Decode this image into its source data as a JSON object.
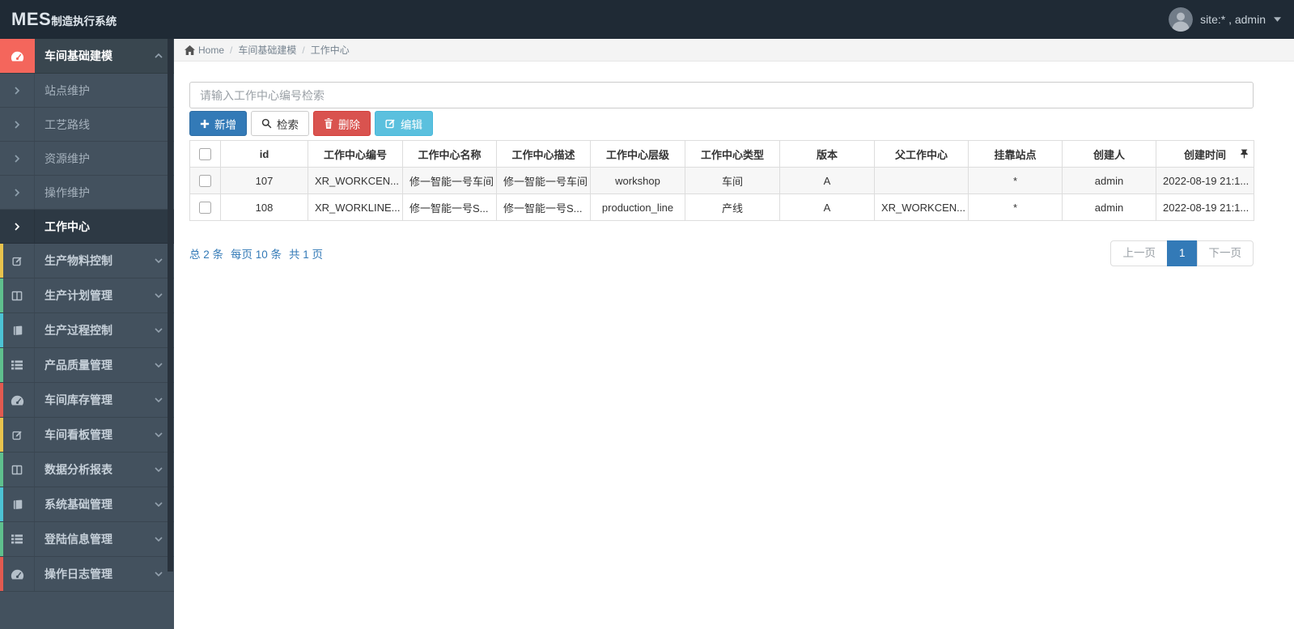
{
  "app": {
    "title_abbr": "MES",
    "title_rest": "制造执行系统"
  },
  "navbar": {
    "user": {
      "label": "site:* , admin",
      "avatar_icon": "user-avatar",
      "caret_icon": "caret-down-icon"
    }
  },
  "sidebar": {
    "items": [
      {
        "kind": "parent",
        "name": "workshop-modeling",
        "label": "车间基础建模",
        "icon": "tachometer-icon",
        "active": true,
        "expanded": true,
        "icon_bg": "#f4665c"
      },
      {
        "kind": "sub",
        "name": "station-maintenance",
        "label": "站点维护"
      },
      {
        "kind": "sub",
        "name": "process-route",
        "label": "工艺路线"
      },
      {
        "kind": "sub",
        "name": "resource-maintenance",
        "label": "资源维护"
      },
      {
        "kind": "sub",
        "name": "operation-maintenance",
        "label": "操作维护"
      },
      {
        "kind": "sub",
        "name": "work-center",
        "label": "工作中心",
        "active": true
      },
      {
        "kind": "parent",
        "name": "material-control",
        "label": "生产物料控制",
        "icon": "edit-icon",
        "strip": "#e8c34d"
      },
      {
        "kind": "parent",
        "name": "plan-management",
        "label": "生产计划管理",
        "icon": "columns-icon",
        "strip": "#5fbf8d"
      },
      {
        "kind": "parent",
        "name": "process-control",
        "label": "生产过程控制",
        "icon": "book-icon",
        "strip": "#4cc2d4"
      },
      {
        "kind": "parent",
        "name": "quality-management",
        "label": "产品质量管理",
        "icon": "list-icon",
        "strip": "#5fbf8d"
      },
      {
        "kind": "parent",
        "name": "inventory-management",
        "label": "车间库存管理",
        "icon": "tachometer-icon",
        "strip": "#e25a50"
      },
      {
        "kind": "parent",
        "name": "kanban-management",
        "label": "车间看板管理",
        "icon": "edit-icon",
        "strip": "#e8c34d"
      },
      {
        "kind": "parent",
        "name": "data-report",
        "label": "数据分析报表",
        "icon": "columns-icon",
        "strip": "#5fbf8d"
      },
      {
        "kind": "parent",
        "name": "system-management",
        "label": "系统基础管理",
        "icon": "book-icon",
        "strip": "#4cc2d4"
      },
      {
        "kind": "parent",
        "name": "login-info-management",
        "label": "登陆信息管理",
        "icon": "list-icon",
        "strip": "#5fbf8d"
      },
      {
        "kind": "parent",
        "name": "operation-log-management",
        "label": "操作日志管理",
        "icon": "tachometer-icon",
        "strip": "#e25a50"
      }
    ]
  },
  "breadcrumb": {
    "home_icon": "home-icon",
    "items": [
      {
        "label": "Home"
      },
      {
        "label": "车间基础建模"
      },
      {
        "label": "工作中心"
      }
    ]
  },
  "toolbar": {
    "search_placeholder": "请输入工作中心编号检索",
    "add_label": "新增",
    "search_label": "检索",
    "delete_label": "删除",
    "edit_label": "编辑"
  },
  "table": {
    "columns": [
      {
        "key": "select",
        "label": "",
        "type": "checkbox"
      },
      {
        "key": "id",
        "label": "id"
      },
      {
        "key": "code",
        "label": "工作中心编号"
      },
      {
        "key": "name",
        "label": "工作中心名称"
      },
      {
        "key": "desc",
        "label": "工作中心描述"
      },
      {
        "key": "level",
        "label": "工作中心层级"
      },
      {
        "key": "type",
        "label": "工作中心类型"
      },
      {
        "key": "version",
        "label": "版本"
      },
      {
        "key": "parent",
        "label": "父工作中心"
      },
      {
        "key": "station",
        "label": "挂靠站点"
      },
      {
        "key": "creator",
        "label": "创建人"
      },
      {
        "key": "created",
        "label": "创建时间",
        "pin": true
      }
    ],
    "rows": [
      {
        "id": "107",
        "code": "XR_WORKCEN...",
        "name": "修一智能一号车间",
        "desc": "修一智能一号车间",
        "level": "workshop",
        "type": "车间",
        "version": "A",
        "parent": "",
        "station": "*",
        "creator": "admin",
        "created": "2022-08-19 21:1..."
      },
      {
        "id": "108",
        "code": "XR_WORKLINE...",
        "name": "修一智能一号S...",
        "desc": "修一智能一号S...",
        "level": "production_line",
        "type": "产线",
        "version": "A",
        "parent": "XR_WORKCEN...",
        "station": "*",
        "creator": "admin",
        "created": "2022-08-19 21:1..."
      }
    ]
  },
  "pagination": {
    "summary": [
      "总 2 条",
      "每页 10 条",
      "共 1 页"
    ],
    "prev_label": "上一页",
    "page": "1",
    "next_label": "下一页"
  },
  "colors": {
    "navbar_bg": "#1f2a35",
    "sidebar_bg": "#43515e",
    "active_accent": "#f4665c",
    "primary": "#337ab7",
    "danger": "#d9534f",
    "info": "#5bc0de"
  }
}
